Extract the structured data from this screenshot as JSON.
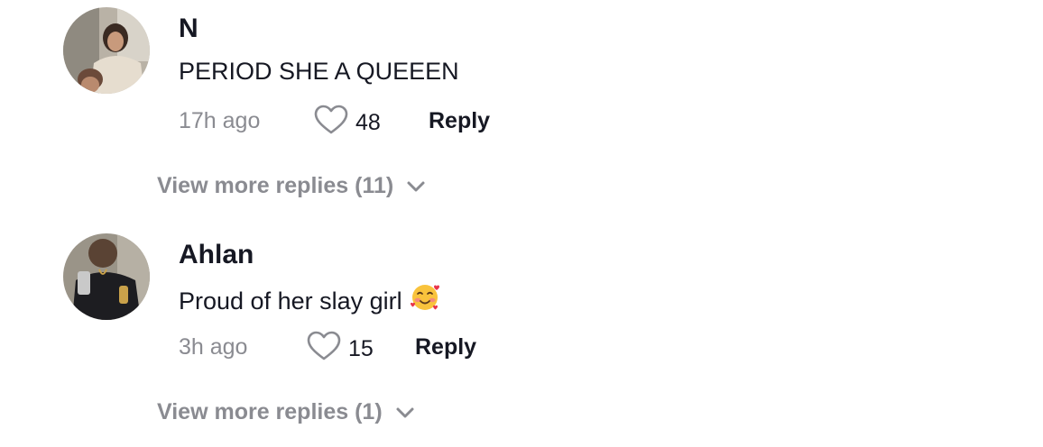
{
  "comments": [
    {
      "username": "N",
      "text": "PERIOD SHE A QUEEEN",
      "time": "17h ago",
      "likes": "48",
      "reply_label": "Reply",
      "view_more_label": "View more replies (11)"
    },
    {
      "username": "Ahlan",
      "text": "Proud of her slay girl",
      "emoji": "smiling-face-with-hearts",
      "time": "3h ago",
      "likes": "15",
      "reply_label": "Reply",
      "view_more_label": "View more replies (1)"
    }
  ],
  "colors": {
    "text_primary": "#161823",
    "text_secondary": "#8a8b91",
    "background": "#ffffff"
  },
  "icons": {
    "like": "heart-outline-icon",
    "expand": "chevron-down-icon"
  }
}
